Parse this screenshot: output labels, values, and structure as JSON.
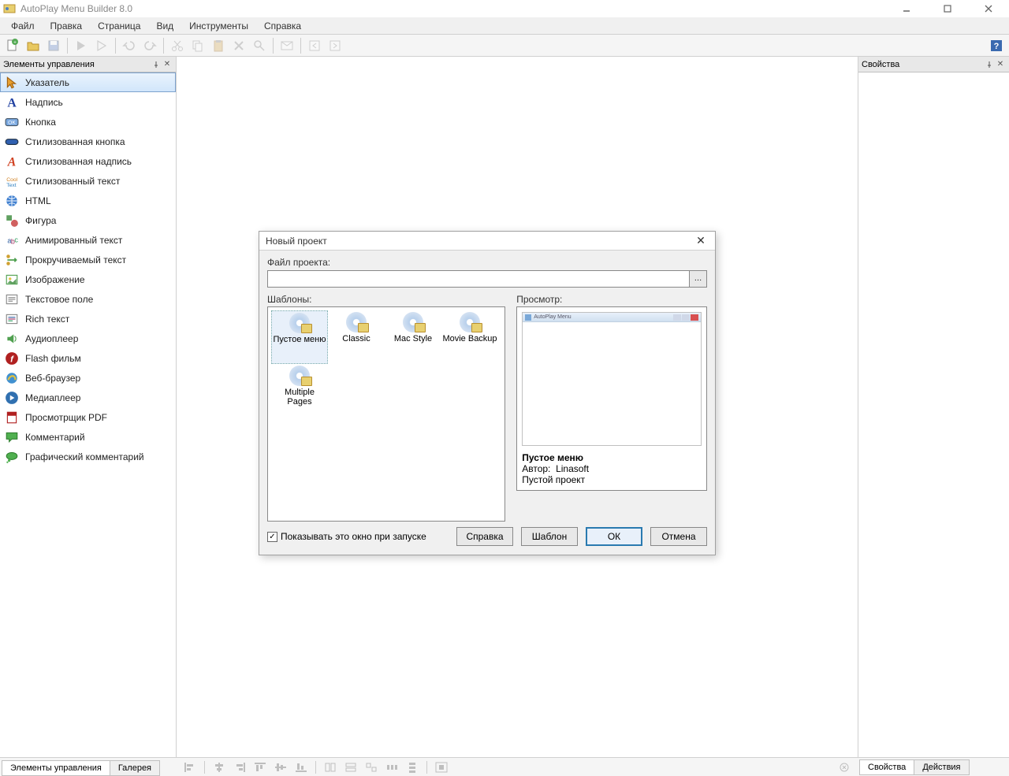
{
  "window": {
    "title": "AutoPlay Menu Builder 8.0"
  },
  "menu": {
    "file": "Файл",
    "edit": "Правка",
    "page": "Страница",
    "view": "Вид",
    "tools": "Инструменты",
    "help": "Справка"
  },
  "panels": {
    "controls_title": "Элементы управления",
    "properties_title": "Свойства",
    "tab_controls": "Элементы управления",
    "tab_gallery": "Галерея",
    "tab_properties": "Свойства",
    "tab_actions": "Действия"
  },
  "controls": [
    {
      "id": "pointer",
      "label": "Указатель"
    },
    {
      "id": "label",
      "label": "Надпись"
    },
    {
      "id": "button",
      "label": "Кнопка"
    },
    {
      "id": "styled-button",
      "label": "Стилизованная кнопка"
    },
    {
      "id": "styled-label",
      "label": "Стилизованная надпись"
    },
    {
      "id": "styled-text",
      "label": "Стилизованный текст"
    },
    {
      "id": "html",
      "label": "HTML"
    },
    {
      "id": "shape",
      "label": "Фигура"
    },
    {
      "id": "animated-text",
      "label": "Анимированный текст"
    },
    {
      "id": "scrolling-text",
      "label": "Прокручиваемый текст"
    },
    {
      "id": "image",
      "label": "Изображение"
    },
    {
      "id": "textbox",
      "label": "Текстовое поле"
    },
    {
      "id": "richtext",
      "label": "Rich текст"
    },
    {
      "id": "audio",
      "label": "Аудиоплеер"
    },
    {
      "id": "flash",
      "label": "Flash фильм"
    },
    {
      "id": "browser",
      "label": "Веб-браузер"
    },
    {
      "id": "media",
      "label": "Медиаплеер"
    },
    {
      "id": "pdf",
      "label": "Просмотрщик PDF"
    },
    {
      "id": "comment",
      "label": "Комментарий"
    },
    {
      "id": "graphic-comment",
      "label": "Графический комментарий"
    }
  ],
  "dialog": {
    "title": "Новый проект",
    "file_label": "Файл проекта:",
    "file_value": "",
    "templates_label": "Шаблоны:",
    "preview_label": "Просмотр:",
    "templates": [
      {
        "id": "empty",
        "label": "Пустое меню"
      },
      {
        "id": "classic",
        "label": "Classic"
      },
      {
        "id": "mac",
        "label": "Mac Style"
      },
      {
        "id": "movie",
        "label": "Movie Backup"
      },
      {
        "id": "multi",
        "label": "Multiple Pages"
      }
    ],
    "preview": {
      "window_title": "AutoPlay Menu",
      "name": "Пустое меню",
      "author_label": "Автор:",
      "author": "Linasoft",
      "description": "Пустой проект"
    },
    "show_on_start": "Показывать это окно при запуске",
    "btn_help": "Справка",
    "btn_template": "Шаблон",
    "btn_ok": "ОК",
    "btn_cancel": "Отмена"
  }
}
